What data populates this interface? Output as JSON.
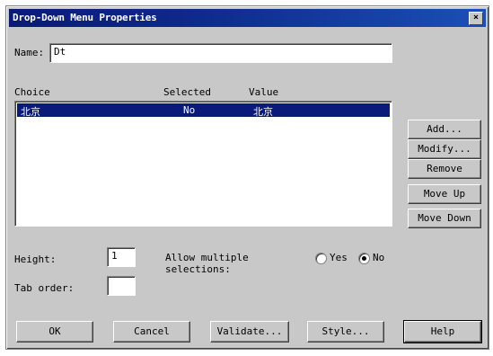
{
  "window": {
    "title": "Drop-Down Menu Properties",
    "close": "×"
  },
  "name_field": {
    "label": "Name:",
    "value": "Dt"
  },
  "list": {
    "headers": {
      "choice": "Choice",
      "selected": "Selected",
      "value": "Value"
    },
    "rows": [
      {
        "choice": "北京",
        "selected": "No",
        "value": "北京"
      }
    ]
  },
  "side_buttons": {
    "add": "Add...",
    "modify": "Modify...",
    "remove": "Remove",
    "move_up": "Move Up",
    "move_down": "Move Down"
  },
  "height": {
    "label": "Height:",
    "value": "1"
  },
  "tab_order": {
    "label": "Tab order:",
    "value": ""
  },
  "allow_multiple": {
    "label_line1": "Allow multiple",
    "label_line2": "selections:",
    "yes_label": "Yes",
    "no_label": "No",
    "selected": "No"
  },
  "bottom_buttons": {
    "ok": "OK",
    "cancel": "Cancel",
    "validate": "Validate...",
    "style": "Style...",
    "help": "Help"
  }
}
